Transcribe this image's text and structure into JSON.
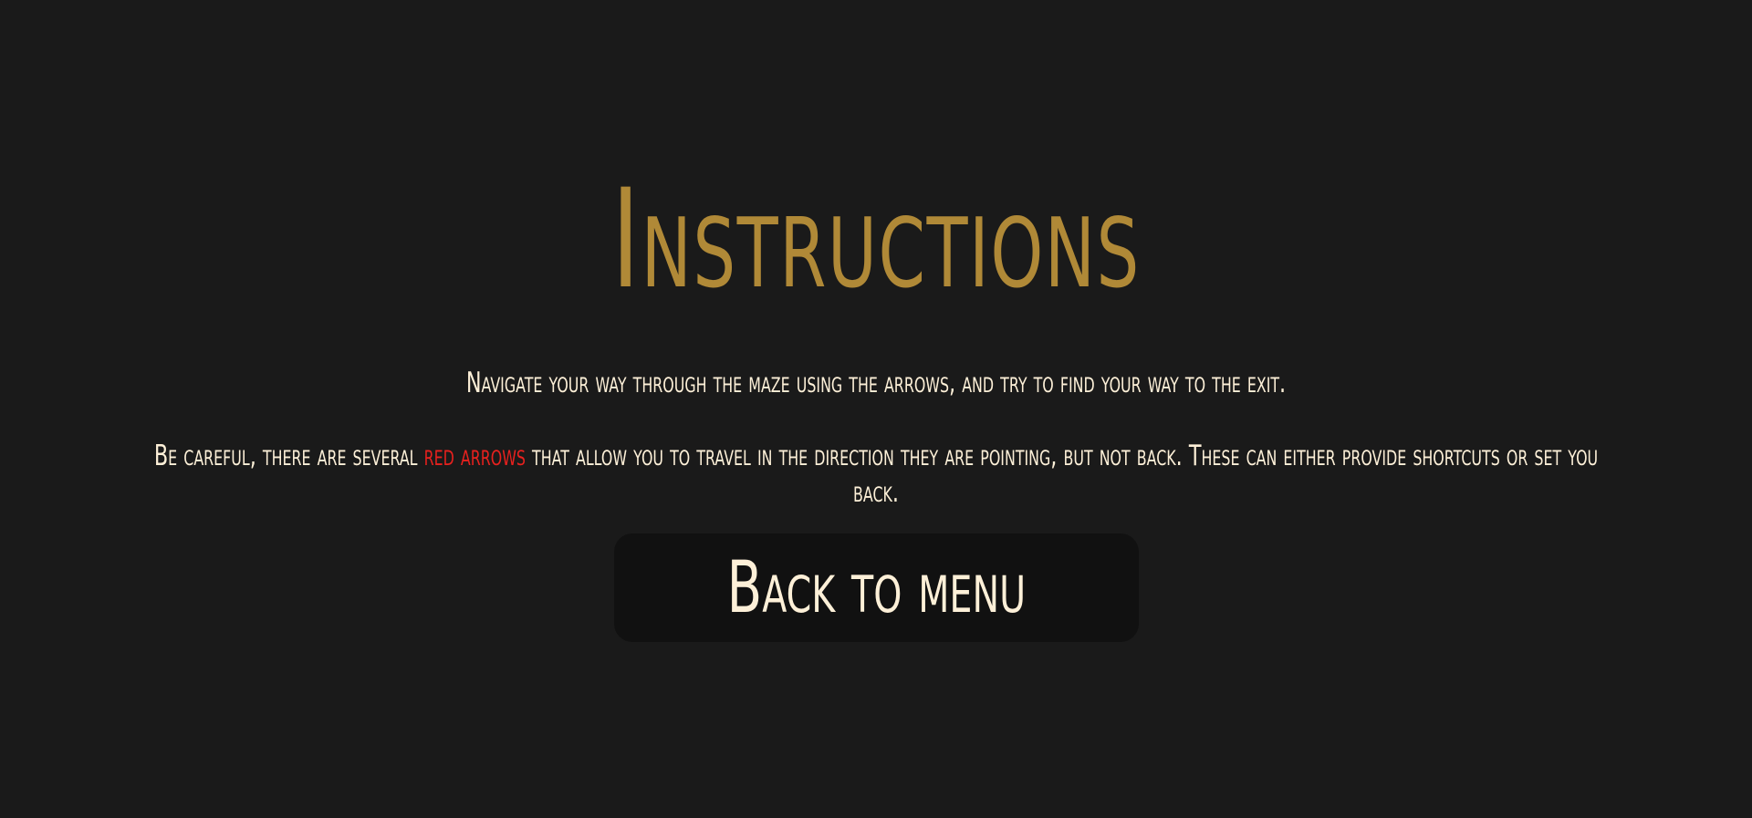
{
  "page": {
    "title": "Instructions"
  },
  "instructions": {
    "line1": "Navigate your way through the maze using the arrows, and try to find your way to the exit.",
    "para2_before": "Be careful, there are several ",
    "para2_highlight": "red arrows",
    "para2_after": " that allow you to travel in the direction they are pointing, but not back. These can either provide shortcuts or set you back."
  },
  "menu": {
    "back_label": "Back to menu"
  },
  "colors": {
    "background": "#1a1a1a",
    "title": "#b08937",
    "text": "#fdf0d8",
    "highlight": "#e8211e",
    "button_bg": "#111111"
  }
}
